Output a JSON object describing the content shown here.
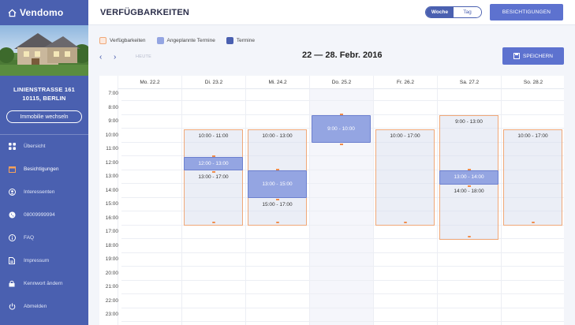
{
  "app": {
    "name": "Vendomo"
  },
  "property": {
    "street": "LINIENSTRASSE 161",
    "city": "10115, BERLIN",
    "switch_label": "Immobilie wechseln"
  },
  "nav": [
    {
      "label": "Übersicht",
      "icon": "grid-icon"
    },
    {
      "label": "Besichtigungen",
      "icon": "calendar-icon"
    },
    {
      "label": "Interessenten",
      "icon": "user-circle-icon"
    },
    {
      "label": "08009999994",
      "icon": "phone-icon"
    },
    {
      "label": "FAQ",
      "icon": "info-icon"
    },
    {
      "label": "Impressum",
      "icon": "document-icon"
    },
    {
      "label": "Kennwort ändern",
      "icon": "lock-icon"
    },
    {
      "label": "Abmelden",
      "icon": "power-icon"
    }
  ],
  "header": {
    "title": "VERFÜGBARKEITEN",
    "view_week": "Woche",
    "view_day": "Tag",
    "action_label": "BESICHTIGUNGEN"
  },
  "legend": [
    {
      "label": "Verfügbarkeiten",
      "color": "#fbe9df"
    },
    {
      "label": "Angeplannte Termine",
      "color": "#94a5e2"
    },
    {
      "label": "Termine",
      "color": "#4a60b0"
    }
  ],
  "toolbar": {
    "today_label": "HEUTE",
    "week_range": "22 — 28. Febr. 2016",
    "save_label": "SPEICHERN"
  },
  "calendar": {
    "days": [
      "Mo. 22.2",
      "Di. 23.2",
      "Mi. 24.2",
      "Do. 25.2",
      "Fr. 26.2",
      "Sa. 27.2",
      "So. 28.2"
    ],
    "today_index": 3,
    "hours": [
      "7:00",
      "8:00",
      "9:00",
      "10:00",
      "11:00",
      "12:00",
      "13:00",
      "14:00",
      "15:00",
      "16:00",
      "17:00",
      "18:00",
      "19:00",
      "20:00",
      "21:00",
      "22:00",
      "23:00"
    ],
    "availabilities": [
      {
        "day": 1,
        "start": 10,
        "end": 17,
        "labels": [
          {
            "text": "10:00 - 11:00",
            "at": 10
          },
          {
            "text": "13:00 - 17:00",
            "at": 13
          }
        ]
      },
      {
        "day": 2,
        "start": 10,
        "end": 17,
        "labels": [
          {
            "text": "10:00 - 13:00",
            "at": 10
          },
          {
            "text": "15:00 - 17:00",
            "at": 15
          }
        ]
      },
      {
        "day": 4,
        "start": 10,
        "end": 17,
        "labels": [
          {
            "text": "10:00 - 17:00",
            "at": 10
          }
        ]
      },
      {
        "day": 5,
        "start": 9,
        "end": 18,
        "labels": [
          {
            "text": "9:00 - 13:00",
            "at": 9
          },
          {
            "text": "14:00 - 18:00",
            "at": 14
          }
        ]
      },
      {
        "day": 6,
        "start": 10,
        "end": 17,
        "labels": [
          {
            "text": "10:00 - 17:00",
            "at": 10
          }
        ]
      }
    ],
    "planned": [
      {
        "day": 1,
        "start": 12,
        "end": 13,
        "label": "12:00 - 13:00"
      },
      {
        "day": 2,
        "start": 13,
        "end": 15,
        "label": "13:00 - 15:00"
      },
      {
        "day": 3,
        "start": 9,
        "end": 11,
        "label": "9:00 - 10:00"
      },
      {
        "day": 5,
        "start": 13,
        "end": 14,
        "label": "13:00 - 14:00"
      }
    ]
  }
}
